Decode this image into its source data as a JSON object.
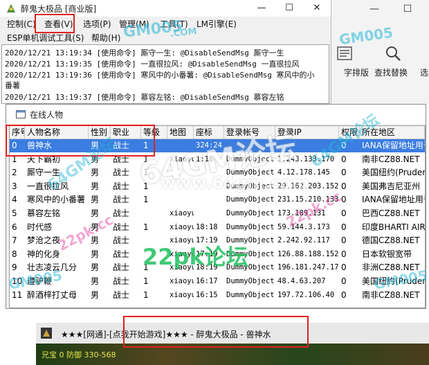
{
  "app": {
    "title": "醉鬼大极品 [商业版]",
    "window_controls": [
      "—",
      "☐",
      "✕"
    ]
  },
  "menu": {
    "row1": [
      "控制(C)",
      "查看(V)",
      "选项(P)",
      "管理(M)",
      "工具(T)",
      "LM引擎(E)"
    ],
    "row2": [
      "ESP单机调试工具(S)",
      "帮助(H)"
    ]
  },
  "log": [
    "2020/12/21 13:19:34 [使用命令] 厮守一生: @DisableSendMsg 厮守一生",
    "2020/12/21 13:19:35 [使用命令] 一直很拉风: @DisableSendMsg 一直很拉风",
    "2020/12/21 13:19:36 [使用命令] 寒风中的小番薯: @DisableSendMsg 寒风中的小",
    "番薯",
    "2020/12/21 13:19:37 [使用命令] 慕容左铭: @DisableSendMsg 慕容左铭"
  ],
  "word_ribbon": {
    "labels": [
      "字排版",
      "查找替换",
      "选"
    ],
    "window_controls": [
      "—",
      "☐"
    ]
  },
  "players": {
    "title": "在线人物",
    "columns": [
      "序号",
      "人物名称",
      "性别",
      "职业",
      "等级",
      "地图",
      "座标",
      "登录帐号",
      "登录IP",
      "权限",
      "所在地区"
    ],
    "rows": [
      [
        "0",
        "兽神水",
        "男",
        "战士",
        "1",
        "",
        "324:24",
        "",
        "",
        "0",
        "IANA保留地址用于"
      ],
      [
        "1",
        "天下霸初",
        "男",
        "战士",
        "1",
        "xiaoyu",
        "1:18",
        "DummyObject",
        "1.243.133.170",
        "0",
        "南非CZ88.NET"
      ],
      [
        "2",
        "厮守一生",
        "男",
        "战士",
        "1",
        "",
        "",
        "DummyObject",
        "4.12.178.145",
        "0",
        "美国纽约(Prudent"
      ],
      [
        "3",
        "一直很拉风",
        "男",
        "战士",
        "1",
        "",
        "",
        "DummyObject",
        "29.162.203.152",
        "0",
        "美国弗吉尼亚州"
      ],
      [
        "4",
        "寒风中的小番薯",
        "男",
        "战士",
        "1",
        "",
        "",
        "DummyObject",
        "231.15.210.133",
        "0",
        "IANA保留地址用于"
      ],
      [
        "5",
        "慕容左铭",
        "男",
        "战士",
        "",
        "xiaoyu",
        "",
        "DummyObject",
        "173.189.131",
        "0",
        "巴西CZ88.NET"
      ],
      [
        "6",
        "时代感",
        "男",
        "战士",
        "1",
        "xiaoyu",
        "18:18",
        "DummyObject",
        "59.144.3.173",
        "0",
        "印度BHARTI AIRT"
      ],
      [
        "7",
        "梦沧之夜",
        "男",
        "战士",
        "",
        "xiaoyu",
        "17:19",
        "DummyObject",
        "2.242.92.117",
        "0",
        "德国CZ88.NET"
      ],
      [
        "8",
        "神的化身",
        "男",
        "战士",
        "",
        "xiaoyu",
        "17:19",
        "DummyObject",
        "126.88.188.152",
        "0",
        "日本软银宽带"
      ],
      [
        "9",
        "壮志凌云几分",
        "男",
        "战士",
        "1",
        "xiaoyu",
        "18:19",
        "DummyObject",
        "196.181.247.179",
        "0",
        "非洲CZ88.NET"
      ],
      [
        "10",
        "遵驴鞭",
        "男",
        "战士",
        "1",
        "xiaoyu",
        "16:17",
        "DummyObject",
        "48.4.63.207",
        "0",
        "美国纽约(Prudent"
      ],
      [
        "11",
        "醉酒梓打丈母",
        "男",
        "战士",
        "1",
        "xiaoyu",
        "16:15",
        "DummyObject",
        "197.72.106.40",
        "0",
        "南非CZ88.NET"
      ]
    ]
  },
  "game": {
    "title": "★★★[网通]-[点我开始游戏]★★★ - 醉鬼大极品 - 兽神水",
    "status": "兄宝 0 防御 330-568"
  },
  "watermarks": {
    "site1": "GM005",
    "site1_sub": ".COM",
    "big": "64GM论坛",
    "small_url": "www.64gm.com",
    "site2": "22pk论坛",
    "site3": "22pk.cc",
    "site4": "64GM论坛"
  },
  "colors": {
    "selection": "#3b7de0",
    "annotation_red": "#e02020",
    "watermark_cyan": "#25b6d6",
    "watermark_green": "#20c060",
    "watermark_pink": "#e23e9a"
  }
}
